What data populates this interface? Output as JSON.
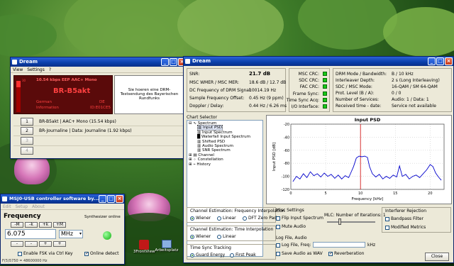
{
  "dream_small": {
    "title": "Dream",
    "menu": [
      "View",
      "Settings",
      "?"
    ],
    "lcd": {
      "line1": "10.54 kbps EEP   AAC+ Mono",
      "label": "BR-B5akt",
      "lang": "German",
      "country": "DE",
      "type": "Information",
      "fid": "ID:E01CE5",
      "level_tick": "30"
    },
    "text_message": "Sie hoeren eine DRM-Testsendung des Bayerischen Rundfunks",
    "services": [
      {
        "num": "1",
        "label": "BR-B5akt  |  AAC+ Mono (15.54 kbps)"
      },
      {
        "num": "2",
        "label": "BR-Journaline  |  Data: Journaline (1.92 kbps)"
      },
      {
        "num": "3",
        "label": ""
      },
      {
        "num": "4",
        "label": ""
      }
    ]
  },
  "dream_main": {
    "title": "Dream",
    "stats": [
      [
        "SNR:",
        "21.7 dB"
      ],
      [
        "MSC WMER / MSC MER:",
        "18.6 dB / 12.7 dB"
      ],
      [
        "DC Frequency of DRM Signal:",
        "10014.19 Hz"
      ],
      [
        "Sample Frequency Offset:",
        "0.45 Hz (9 ppm)"
      ],
      [
        "Doppler / Delay:",
        "0.44 Hz / 6.26 ms"
      ]
    ],
    "crcs": [
      "MSC CRC:",
      "SDC CRC:",
      "FAC CRC:",
      "Frame Sync:",
      "Time Sync Acq:",
      "I/O Interface:"
    ],
    "info": [
      [
        "DRM Mode / Bandwidth:",
        "B / 10 kHz"
      ],
      [
        "Interleaver Depth:",
        "2 s (Long Interleaving)"
      ],
      [
        "SDC / MSC Mode:",
        "16-QAM / SM 64-QAM"
      ],
      [
        "Prot. Level (B / A):",
        "0 / 0"
      ],
      [
        "Number of Services:",
        "Audio: 1 / Data: 1"
      ],
      [
        "Received time - date:",
        "Service not available"
      ]
    ],
    "chart_selector": "Chart Selector",
    "tree": [
      "Spectrum",
      "Input PSD",
      "Input Spectrum",
      "Waterfall Input Spectrum",
      "Shifted PSD",
      "Audio Spectrum",
      "SNR Spectrum",
      "Channel",
      "Constellation",
      "History"
    ],
    "ch_est_freq": {
      "title": "Channel Estimation: Frequency Interpolation",
      "opts": [
        "Wiener",
        "Linear",
        "DFT Zero Pad"
      ]
    },
    "ch_est_time": {
      "title": "Channel Estimation: Time Interpolation",
      "opts": [
        "Wiener",
        "Linear"
      ]
    },
    "time_sync": {
      "title": "Time Sync Tracking",
      "opts": [
        "Guard Energy",
        "First Peak"
      ]
    },
    "misc": {
      "title": "Misc Settings",
      "flip": "Flip Input Spectrum",
      "mute": "Mute Audio",
      "mlc": "MLC: Number of Iterations: 1"
    },
    "interf": {
      "title": "Interferer Rejection",
      "opts": [
        "Bandpass Filter",
        "Modified Metrics"
      ]
    },
    "logfile": {
      "title": "Log File, Audio",
      "logfreq": "Log File, Freq:",
      "khz": "kHz",
      "wav": "Save Audio as WAV",
      "reverb": "Reverberation"
    },
    "close": "Close"
  },
  "chart_data": {
    "type": "line",
    "title": "Input PSD",
    "xlabel": "Frequency [kHz]",
    "ylabel": "Input PSD [dB]",
    "xlim": [
      0,
      22
    ],
    "ylim": [
      -120,
      -20
    ],
    "xticks": [
      0,
      5,
      10,
      15,
      20
    ],
    "yticks": [
      -20,
      -40,
      -60,
      -80,
      -100,
      -120
    ],
    "marker_x": 10,
    "series": [
      {
        "values": [
          [
            0.3,
            -108
          ],
          [
            0.8,
            -100
          ],
          [
            1.3,
            -104
          ],
          [
            1.8,
            -96
          ],
          [
            2.3,
            -102
          ],
          [
            2.8,
            -93
          ],
          [
            3.3,
            -99
          ],
          [
            3.8,
            -96
          ],
          [
            4.3,
            -101
          ],
          [
            4.8,
            -95
          ],
          [
            5.3,
            -100
          ],
          [
            5.8,
            -97
          ],
          [
            6.3,
            -103
          ],
          [
            6.8,
            -98
          ],
          [
            7.3,
            -104
          ],
          [
            7.8,
            -99
          ],
          [
            8.3,
            -102
          ],
          [
            8.6,
            -95
          ],
          [
            9.0,
            -85
          ],
          [
            9.4,
            -72
          ],
          [
            9.8,
            -69
          ],
          [
            10.2,
            -70
          ],
          [
            10.6,
            -69
          ],
          [
            11.0,
            -71
          ],
          [
            11.3,
            -85
          ],
          [
            11.7,
            -96
          ],
          [
            12.2,
            -101
          ],
          [
            12.7,
            -97
          ],
          [
            13.2,
            -104
          ],
          [
            13.7,
            -100
          ],
          [
            14.2,
            -103
          ],
          [
            14.7,
            -98
          ],
          [
            15.2,
            -101
          ],
          [
            15.6,
            -84
          ],
          [
            16.0,
            -100
          ],
          [
            16.5,
            -97
          ],
          [
            17.0,
            -104
          ],
          [
            17.5,
            -100
          ],
          [
            18.0,
            -98
          ],
          [
            18.5,
            -102
          ],
          [
            19.0,
            -96
          ],
          [
            19.5,
            -90
          ],
          [
            20.0,
            -82
          ],
          [
            20.4,
            -85
          ],
          [
            20.8,
            -95
          ],
          [
            21.2,
            -101
          ],
          [
            21.6,
            -106
          ]
        ]
      }
    ]
  },
  "usb": {
    "title": "MSJ0-USB controller software by...",
    "menu": [
      "Edit",
      "Setup",
      "About"
    ],
    "freq_label": "Frequency",
    "synth": "Synthesizer online",
    "steps": [
      "-M",
      "-k",
      "+k",
      "+M",
      "-",
      "-",
      "+",
      "+"
    ],
    "freq_value": "6.075",
    "unit": "MHz",
    "fsk": "Enable FSK via Ctrl Key",
    "online": "Online detect",
    "status": "F(5)5750 = 48600000 Hz"
  },
  "desktop": [
    {
      "label": "3FrontView"
    },
    {
      "label": "Arbeitsplatz"
    }
  ],
  "colors": {
    "title": "#0a3ea8",
    "led": "#18c818",
    "lcd_bg": "#5a0a0a",
    "lcd_text": "#ff4040",
    "plot_line": "#0000cc",
    "marker": "#cc0000"
  }
}
